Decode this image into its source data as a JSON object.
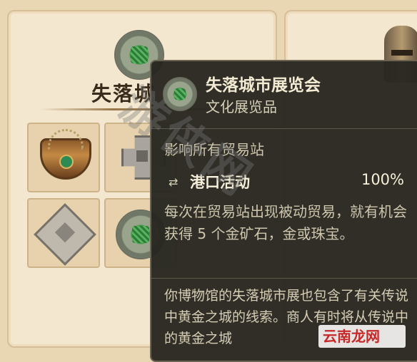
{
  "panel": {
    "title": "失落城"
  },
  "tooltip": {
    "title": "失落城市展览会",
    "subtitle": "文化展览品",
    "scope": "影响所有贸易站",
    "effect": {
      "name": "港口活动",
      "value": "100%"
    },
    "effect_description": "每次在贸易站出现被动贸易，就有机会获得 5 个金矿石，金或珠宝。",
    "lore": "你博物馆的失落城市展也包含了有关传说中黄金之城的线索。商人有时将从传说中的黄金之城"
  },
  "icons": [
    "medal-icon",
    "necklace-icon",
    "ruin-icon",
    "helmet-icon",
    "swap-icon"
  ],
  "watermark": "游侠网",
  "site_watermark": "云南龙网",
  "colors": {
    "tooltip_bg": "#28261f",
    "parchment": "#f4e7cf",
    "accent_green": "#3f9a46"
  }
}
